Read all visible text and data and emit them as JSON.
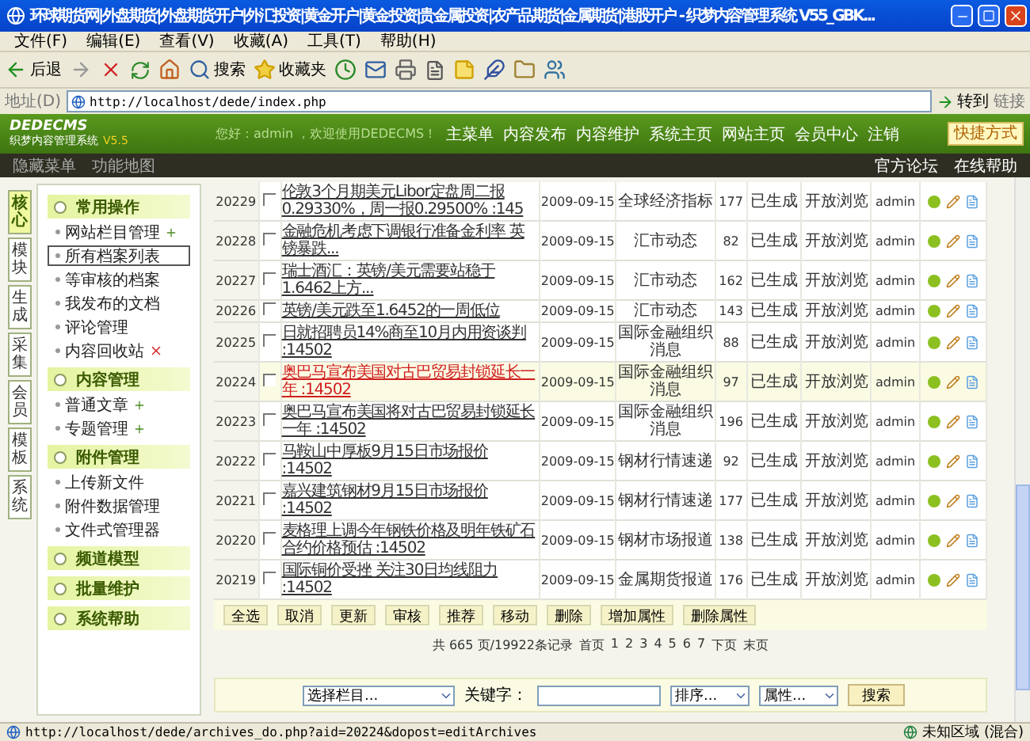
{
  "window": {
    "title": "环球期货网|外盘期货|外盘期货开户|外汇投资|黄金开户|黄金投资|贵金属投资|农产品期货|金属期货|港股开户 - 织梦内容管理系统 V55_GBK..."
  },
  "menu": [
    "文件(F)",
    "编辑(E)",
    "查看(V)",
    "收藏(A)",
    "工具(T)",
    "帮助(H)"
  ],
  "toolbar": {
    "back": "后退",
    "search": "搜索",
    "favorites": "收藏夹"
  },
  "address": {
    "label": "地址(D)",
    "url": "http://localhost/dede/index.php",
    "go": "转到",
    "links": "链接"
  },
  "header": {
    "logo": "DEDECMS",
    "logo_sub": "织梦内容管理系统",
    "version": "V5.5",
    "greeting": "您好：admin ，欢迎使用DEDECMS！",
    "nav": [
      "主菜单",
      "内容发布",
      "内容维护",
      "系统主页",
      "网站主页",
      "会员中心",
      "注销"
    ],
    "quick": "快捷方式"
  },
  "subbar": {
    "left": [
      "隐藏菜单",
      "功能地图"
    ],
    "right": [
      "官方论坛",
      "在线帮助"
    ]
  },
  "side_tabs": [
    {
      "label": "核心",
      "selected": true
    },
    {
      "label": "模块",
      "selected": false
    },
    {
      "label": "生成",
      "selected": false
    },
    {
      "label": "采集",
      "selected": false
    },
    {
      "label": "会员",
      "selected": false
    },
    {
      "label": "模板",
      "selected": false
    },
    {
      "label": "系统",
      "selected": false
    }
  ],
  "menu_groups": [
    {
      "title": "常用操作",
      "items": [
        {
          "label": "网站栏目管理",
          "kind": "add",
          "selected": false
        },
        {
          "label": "所有档案列表",
          "kind": "plain",
          "selected": true
        },
        {
          "label": "等审核的档案",
          "kind": "plain",
          "selected": false
        },
        {
          "label": "我发布的文档",
          "kind": "plain",
          "selected": false
        },
        {
          "label": "评论管理",
          "kind": "plain",
          "selected": false
        },
        {
          "label": "内容回收站",
          "kind": "delete",
          "selected": false
        }
      ]
    },
    {
      "title": "内容管理",
      "items": [
        {
          "label": "普通文章",
          "kind": "add",
          "selected": false
        },
        {
          "label": "专题管理",
          "kind": "add",
          "selected": false
        }
      ]
    },
    {
      "title": "附件管理",
      "items": [
        {
          "label": "上传新文件",
          "kind": "plain",
          "selected": false
        },
        {
          "label": "附件数据管理",
          "kind": "plain",
          "selected": false
        },
        {
          "label": "文件式管理器",
          "kind": "plain",
          "selected": false
        }
      ]
    },
    {
      "title": "频道模型"
    },
    {
      "title": "批量维护"
    },
    {
      "title": "系统帮助"
    }
  ],
  "rows": [
    {
      "id": "20229",
      "checked": false,
      "selected": false,
      "title": "伦敦3个月期美元Libor定盘周二报0.29330%，周一报0.29500% :145",
      "date": "2009-09-15",
      "category": "全球经济指标",
      "clicks": "177",
      "status": "已生成",
      "access": "开放浏览",
      "author": "admin"
    },
    {
      "id": "20228",
      "checked": false,
      "selected": false,
      "title": "金融危机考虑下调银行准备金利率 英镑暴跌...",
      "date": "2009-09-15",
      "category": "汇市动态",
      "clicks": "82",
      "status": "已生成",
      "access": "开放浏览",
      "author": "admin"
    },
    {
      "id": "20227",
      "checked": false,
      "selected": false,
      "title": "瑞士酒汇：英镑/美元需要站稳于1.6462上方...",
      "date": "2009-09-15",
      "category": "汇市动态",
      "clicks": "162",
      "status": "已生成",
      "access": "开放浏览",
      "author": "admin"
    },
    {
      "id": "20226",
      "checked": false,
      "selected": false,
      "title": "英镑/美元跌至1.6452的一周低位",
      "date": "2009-09-15",
      "category": "汇市动态",
      "clicks": "143",
      "status": "已生成",
      "access": "开放浏览",
      "author": "admin"
    },
    {
      "id": "20225",
      "checked": false,
      "selected": false,
      "title": "日就招聘员14%商至10月内用资谈判 :14502",
      "date": "2009-09-15",
      "category": "国际金融组织消息",
      "clicks": "88",
      "status": "已生成",
      "access": "开放浏览",
      "author": "admin"
    },
    {
      "id": "20224",
      "checked": false,
      "selected": true,
      "title": "奥巴马宣布美国对古巴贸易封锁延长一年 :14502",
      "date": "2009-09-15",
      "category": "国际金融组织消息",
      "clicks": "97",
      "status": "已生成",
      "access": "开放浏览",
      "author": "admin"
    },
    {
      "id": "20223",
      "checked": false,
      "selected": false,
      "title": "奥巴马宣布美国将对古巴贸易封锁延长一年 :14502",
      "date": "2009-09-15",
      "category": "国际金融组织消息",
      "clicks": "196",
      "status": "已生成",
      "access": "开放浏览",
      "author": "admin"
    },
    {
      "id": "20222",
      "checked": false,
      "selected": false,
      "title": "马鞍山中厚板9月15日市场报价 :14502",
      "date": "2009-09-15",
      "category": "钢材行情速递",
      "clicks": "92",
      "status": "已生成",
      "access": "开放浏览",
      "author": "admin"
    },
    {
      "id": "20221",
      "checked": false,
      "selected": false,
      "title": "嘉兴建筑钢材9月15日市场报价 :14502",
      "date": "2009-09-15",
      "category": "钢材行情速递",
      "clicks": "177",
      "status": "已生成",
      "access": "开放浏览",
      "author": "admin"
    },
    {
      "id": "20220",
      "checked": false,
      "selected": false,
      "title": "麦格理上调今年钢铁价格及明年铁矿石合约价格预估 :14502",
      "date": "2009-09-15",
      "category": "钢材市场报道",
      "clicks": "138",
      "status": "已生成",
      "access": "开放浏览",
      "author": "admin"
    },
    {
      "id": "20219",
      "checked": false,
      "selected": false,
      "title": "国际铜价受挫 关注30日均线阻力 :14502",
      "date": "2009-09-15",
      "category": "金属期货报道",
      "clicks": "176",
      "status": "已生成",
      "access": "开放浏览",
      "author": "admin"
    }
  ],
  "actions": [
    "全选",
    "取消",
    "更新",
    "审核",
    "推荐",
    "移动",
    "删除",
    "增加属性",
    "删除属性"
  ],
  "pager": {
    "summary": "共 665 页/19922条记录",
    "first": "首页",
    "pages": [
      "1",
      "2",
      "3",
      "4",
      "5",
      "6",
      "7"
    ],
    "next": "下页",
    "last": "末页"
  },
  "search": {
    "channel": "选择栏目...",
    "keyword_label": "关键字：",
    "order": "排序...",
    "attr": "属性...",
    "button": "搜索"
  },
  "status_bar": {
    "url": "http://localhost/dede/archives_do.php?aid=20224&dopost=editArchives",
    "zone": "未知区域 (混合)"
  }
}
